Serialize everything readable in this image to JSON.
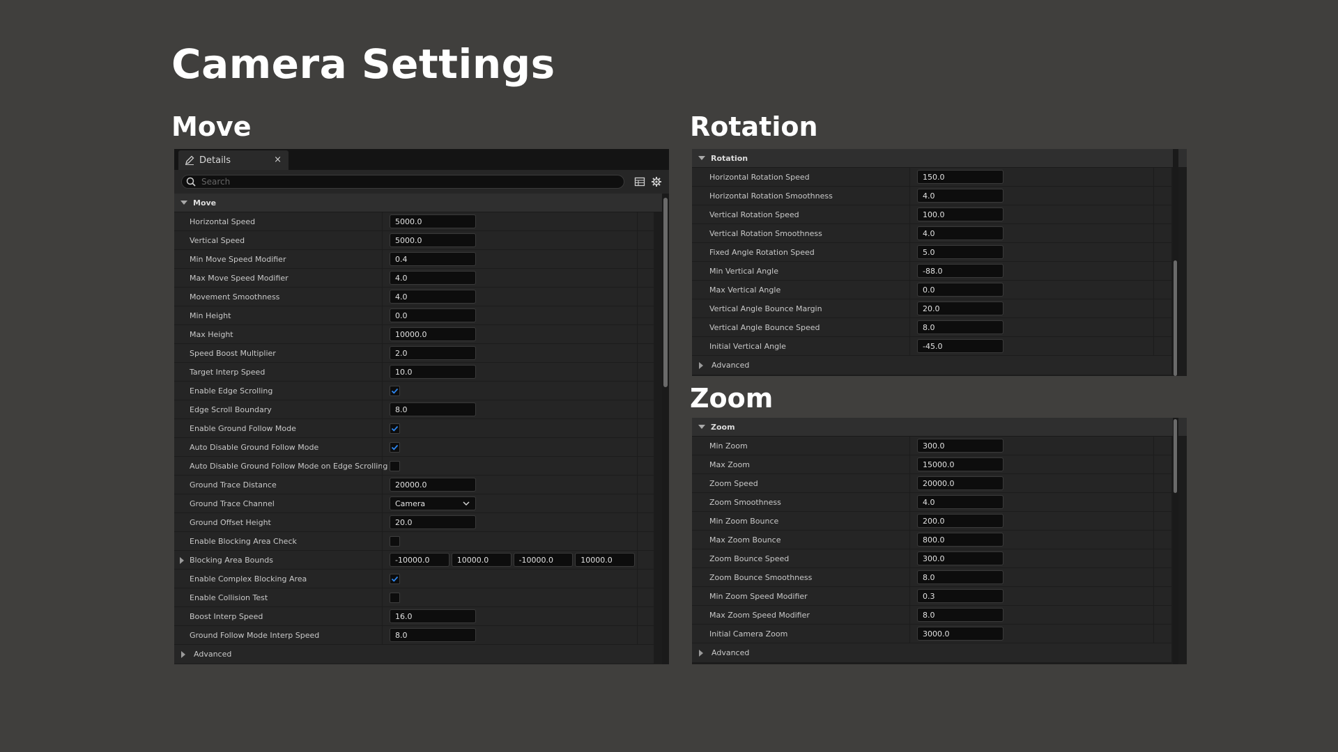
{
  "page_title": "Camera Settings",
  "sections": {
    "move_title": "Move",
    "rotation_title": "Rotation",
    "zoom_title": "Zoom"
  },
  "move_panel": {
    "tab_label": "Details",
    "tab_close": "×",
    "search_placeholder": "Search",
    "category": "Move",
    "rows": [
      {
        "label": "Horizontal Speed",
        "type": "number",
        "value": "5000.0"
      },
      {
        "label": "Vertical Speed",
        "type": "number",
        "value": "5000.0"
      },
      {
        "label": "Min Move Speed Modifier",
        "type": "number",
        "value": "0.4"
      },
      {
        "label": "Max Move Speed Modifier",
        "type": "number",
        "value": "4.0"
      },
      {
        "label": "Movement Smoothness",
        "type": "number",
        "value": "4.0"
      },
      {
        "label": "Min Height",
        "type": "number",
        "value": "0.0"
      },
      {
        "label": "Max Height",
        "type": "number",
        "value": "10000.0"
      },
      {
        "label": "Speed Boost Multiplier",
        "type": "number",
        "value": "2.0"
      },
      {
        "label": "Target Interp Speed",
        "type": "number",
        "value": "10.0"
      },
      {
        "label": "Enable Edge Scrolling",
        "type": "checkbox",
        "checked": true
      },
      {
        "label": "Edge Scroll Boundary",
        "type": "number",
        "value": "8.0"
      },
      {
        "label": "Enable Ground Follow Mode",
        "type": "checkbox",
        "checked": true
      },
      {
        "label": "Auto Disable Ground Follow Mode",
        "type": "checkbox",
        "checked": true
      },
      {
        "label": "Auto Disable Ground Follow Mode on Edge Scrolling",
        "type": "checkbox",
        "checked": false
      },
      {
        "label": "Ground Trace Distance",
        "type": "number",
        "value": "20000.0"
      },
      {
        "label": "Ground Trace Channel",
        "type": "dropdown",
        "value": "Camera"
      },
      {
        "label": "Ground Offset Height",
        "type": "number",
        "value": "20.0"
      },
      {
        "label": "Enable Blocking Area Check",
        "type": "checkbox",
        "checked": false
      },
      {
        "label": "Blocking Area Bounds",
        "type": "multi",
        "values": [
          "-10000.0",
          "10000.0",
          "-10000.0",
          "10000.0"
        ],
        "expandable": true
      },
      {
        "label": "Enable Complex Blocking Area",
        "type": "checkbox",
        "checked": true
      },
      {
        "label": "Enable Collision Test",
        "type": "checkbox",
        "checked": false
      },
      {
        "label": "Boost Interp Speed",
        "type": "number",
        "value": "16.0"
      },
      {
        "label": "Ground Follow Mode Interp Speed",
        "type": "number",
        "value": "8.0"
      }
    ],
    "advanced_label": "Advanced"
  },
  "rotation_panel": {
    "category": "Rotation",
    "rows": [
      {
        "label": "Horizontal Rotation Speed",
        "value": "150.0"
      },
      {
        "label": "Horizontal Rotation Smoothness",
        "value": "4.0"
      },
      {
        "label": "Vertical Rotation Speed",
        "value": "100.0"
      },
      {
        "label": "Vertical Rotation Smoothness",
        "value": "4.0"
      },
      {
        "label": "Fixed Angle Rotation Speed",
        "value": "5.0"
      },
      {
        "label": "Min Vertical Angle",
        "value": "-88.0"
      },
      {
        "label": "Max Vertical Angle",
        "value": "0.0"
      },
      {
        "label": "Vertical Angle Bounce Margin",
        "value": "20.0"
      },
      {
        "label": "Vertical Angle Bounce Speed",
        "value": "8.0"
      },
      {
        "label": "Initial Vertical Angle",
        "value": "-45.0"
      }
    ],
    "advanced_label": "Advanced"
  },
  "zoom_panel": {
    "category": "Zoom",
    "rows": [
      {
        "label": "Min Zoom",
        "value": "300.0"
      },
      {
        "label": "Max Zoom",
        "value": "15000.0"
      },
      {
        "label": "Zoom Speed",
        "value": "20000.0"
      },
      {
        "label": "Zoom Smoothness",
        "value": "4.0"
      },
      {
        "label": "Min Zoom Bounce",
        "value": "200.0"
      },
      {
        "label": "Max Zoom Bounce",
        "value": "800.0"
      },
      {
        "label": "Zoom Bounce Speed",
        "value": "300.0"
      },
      {
        "label": "Zoom Bounce Smoothness",
        "value": "8.0"
      },
      {
        "label": "Min Zoom Speed Modifier",
        "value": "0.3"
      },
      {
        "label": "Max Zoom Speed Modifier",
        "value": "8.0"
      },
      {
        "label": "Initial Camera Zoom",
        "value": "3000.0"
      }
    ],
    "advanced_label": "Advanced"
  },
  "colors": {
    "background": "#403f3d",
    "panel": "#1c1c1c",
    "row": "#252525",
    "checkbox_accent": "#1f7ae0"
  }
}
